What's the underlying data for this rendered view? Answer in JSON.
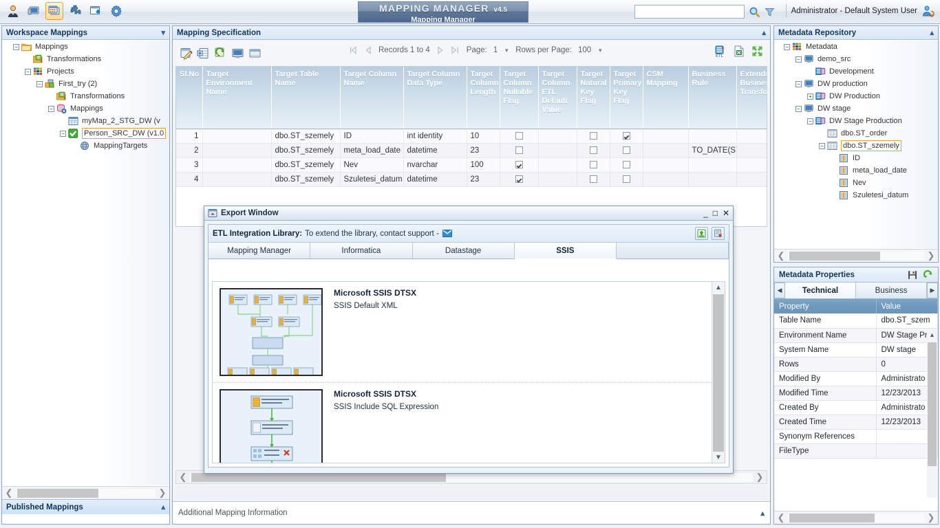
{
  "app": {
    "brand_title": "MAPPING MANAGER",
    "brand_version": "v4.5",
    "brand_subtitle": "Mapping Manager",
    "user_label": "Administrator - Default System User",
    "search_value": "",
    "search_placeholder": "",
    "toolbar_icons": [
      "user-icon",
      "monitor-icon",
      "mapping-window-icon",
      "puzzle-icon",
      "import-window-icon",
      "gear-icon"
    ]
  },
  "left_panel": {
    "title": "Workspace Mappings",
    "tree": [
      {
        "label": "Mappings",
        "indent": 0,
        "toggle": "minus",
        "icon": "folder-icon"
      },
      {
        "label": "Transformations",
        "indent": 1,
        "toggle": "none",
        "icon": "transform-icon"
      },
      {
        "label": "Projects",
        "indent": 1,
        "toggle": "minus",
        "icon": "grid-color-icon"
      },
      {
        "label": "First_try (2)",
        "indent": 2,
        "toggle": "minus",
        "icon": "project-icon"
      },
      {
        "label": "Transformations",
        "indent": 3,
        "toggle": "none",
        "icon": "transform-icon"
      },
      {
        "label": "Mappings",
        "indent": 3,
        "toggle": "minus",
        "icon": "db-map-icon"
      },
      {
        "label": "myMap_2_STG_DW (v",
        "indent": 4,
        "toggle": "none",
        "icon": "table-blue-icon"
      },
      {
        "label": "Person_SRC_DW (v1.0",
        "indent": 4,
        "toggle": "minus",
        "icon": "check-green-icon",
        "selected": true
      },
      {
        "label": "MappingTargets",
        "indent": 5,
        "toggle": "none",
        "icon": "globe-icon"
      }
    ],
    "published_title": "Published Mappings"
  },
  "center_panel": {
    "title": "Mapping Specification",
    "tools": [
      "edit-icon",
      "insert-row-icon",
      "refresh-icon",
      "monitor-icon",
      "list-icon"
    ],
    "pager": {
      "first_label": "⏮",
      "prev_label": "◁",
      "records_label": "Records 1 to 4",
      "next_label": "▷",
      "last_label": "⏭",
      "page_label": "Page:",
      "page_value": "1",
      "rows_label": "Rows per Page:",
      "rows_value": "100"
    },
    "right_icons": [
      "etl-export-icon",
      "excel-export-icon",
      "expand-icon"
    ],
    "grid": {
      "columns": [
        "Sl.No",
        "Target Environment Name",
        "Target Table Name",
        "Target Column Name",
        "Target Column Data Type",
        "Target Column Length",
        "Target Column Nullable Flag",
        "Target Column ETL Default Value",
        "Target Natural Key Flag",
        "Target Primary Key Flag",
        "CSM Mapping",
        "Business Rule",
        "Extended Business Transform"
      ],
      "rows": [
        {
          "no": "1",
          "env": "",
          "table": "dbo.ST_szemely",
          "column": "ID",
          "dtype": "int identity",
          "length": "10",
          "nullable": false,
          "etl_default": "",
          "natural_key": false,
          "primary_key": true,
          "csm": "",
          "business_rule": "",
          "ext": ""
        },
        {
          "no": "2",
          "env": "",
          "table": "dbo.ST_szemely",
          "column": "meta_load_date",
          "dtype": "datetime",
          "length": "23",
          "nullable": false,
          "etl_default": "",
          "natural_key": false,
          "primary_key": false,
          "csm": "",
          "business_rule": "TO_DATE(SY",
          "ext": ""
        },
        {
          "no": "3",
          "env": "",
          "table": "dbo.ST_szemely",
          "column": "Nev",
          "dtype": "nvarchar",
          "length": "100",
          "nullable": true,
          "etl_default": "",
          "natural_key": false,
          "primary_key": false,
          "csm": "",
          "business_rule": "",
          "ext": ""
        },
        {
          "no": "4",
          "env": "",
          "table": "dbo.ST_szemely",
          "column": "Szuletesi_datum",
          "dtype": "datetime",
          "length": "23",
          "nullable": true,
          "etl_default": "",
          "natural_key": false,
          "primary_key": false,
          "csm": "",
          "business_rule": "",
          "ext": ""
        }
      ]
    },
    "additional_info": "Additional Mapping Information"
  },
  "dialog": {
    "title": "Export Window",
    "minimize_label": "_",
    "maximize_label": "□",
    "close_label": "✕",
    "etl_label": "ETL Integration Library:",
    "etl_text": "To extend the library, contact support -",
    "etl_buttons": [
      "upload-green-icon",
      "cancel-export-icon"
    ],
    "tabs": [
      {
        "label": "Mapping Manager",
        "active": false
      },
      {
        "label": "Informatica",
        "active": false
      },
      {
        "label": "Datastage",
        "active": false
      },
      {
        "label": "SSIS",
        "active": true
      }
    ],
    "items": [
      {
        "title": "Microsoft SSIS DTSX",
        "subtitle": "SSIS Default XML",
        "thumb": "ssis-flow-wide"
      },
      {
        "title": "Microsoft SSIS DTSX",
        "subtitle": "SSIS Include SQL Expression",
        "thumb": "ssis-flow-linear"
      }
    ]
  },
  "right_panel": {
    "repo_title": "Metadata Repository",
    "repo_tree": [
      {
        "label": "Metadata",
        "indent": 0,
        "toggle": "minus",
        "icon": "grid-color-icon"
      },
      {
        "label": "demo_src",
        "indent": 1,
        "toggle": "minus",
        "icon": "monitor-icon"
      },
      {
        "label": "Development",
        "indent": 2,
        "toggle": "none",
        "icon": "db-icon"
      },
      {
        "label": "DW production",
        "indent": 1,
        "toggle": "minus",
        "icon": "monitor-icon"
      },
      {
        "label": "DW Production",
        "indent": 2,
        "toggle": "plus",
        "icon": "db-icon"
      },
      {
        "label": "DW stage",
        "indent": 1,
        "toggle": "minus",
        "icon": "monitor-icon"
      },
      {
        "label": "DW Stage Production",
        "indent": 2,
        "toggle": "minus",
        "icon": "db-icon"
      },
      {
        "label": "dbo.ST_order",
        "indent": 3,
        "toggle": "none",
        "icon": "table-icon"
      },
      {
        "label": "dbo.ST_szemely",
        "indent": 3,
        "toggle": "minus",
        "icon": "table-icon",
        "selected": true
      },
      {
        "label": "ID",
        "indent": 4,
        "toggle": "none",
        "icon": "column-icon"
      },
      {
        "label": "meta_load_date",
        "indent": 4,
        "toggle": "none",
        "icon": "column-icon"
      },
      {
        "label": "Nev",
        "indent": 4,
        "toggle": "none",
        "icon": "column-icon"
      },
      {
        "label": "Szuletesi_datum",
        "indent": 4,
        "toggle": "none",
        "icon": "column-icon"
      }
    ],
    "props_title": "Metadata Properties",
    "props_icons": [
      "save-icon",
      "refresh-icon"
    ],
    "props_tabs": [
      {
        "label": "Technical",
        "active": true
      },
      {
        "label": "Business",
        "active": false
      }
    ],
    "props_headers": [
      "Property",
      "Value"
    ],
    "props_rows": [
      {
        "property": "Table Name",
        "value": "dbo.ST_szem"
      },
      {
        "property": "Environment Name",
        "value": "DW Stage Pr"
      },
      {
        "property": "System Name",
        "value": "DW stage"
      },
      {
        "property": "Rows",
        "value": "0"
      },
      {
        "property": "Modified By",
        "value": "Administrato"
      },
      {
        "property": "Modified Time",
        "value": "12/23/2013 "
      },
      {
        "property": "Created By",
        "value": "Administrato"
      },
      {
        "property": "Created Time",
        "value": "12/23/2013 "
      },
      {
        "property": "Synonym References",
        "value": ""
      },
      {
        "property": "FileType",
        "value": ""
      }
    ]
  },
  "colors": {
    "accent_blue": "#2e5f94",
    "header_blue": "#6e99bd",
    "selection_orange": "#e0a33a",
    "green": "#55aa33"
  }
}
